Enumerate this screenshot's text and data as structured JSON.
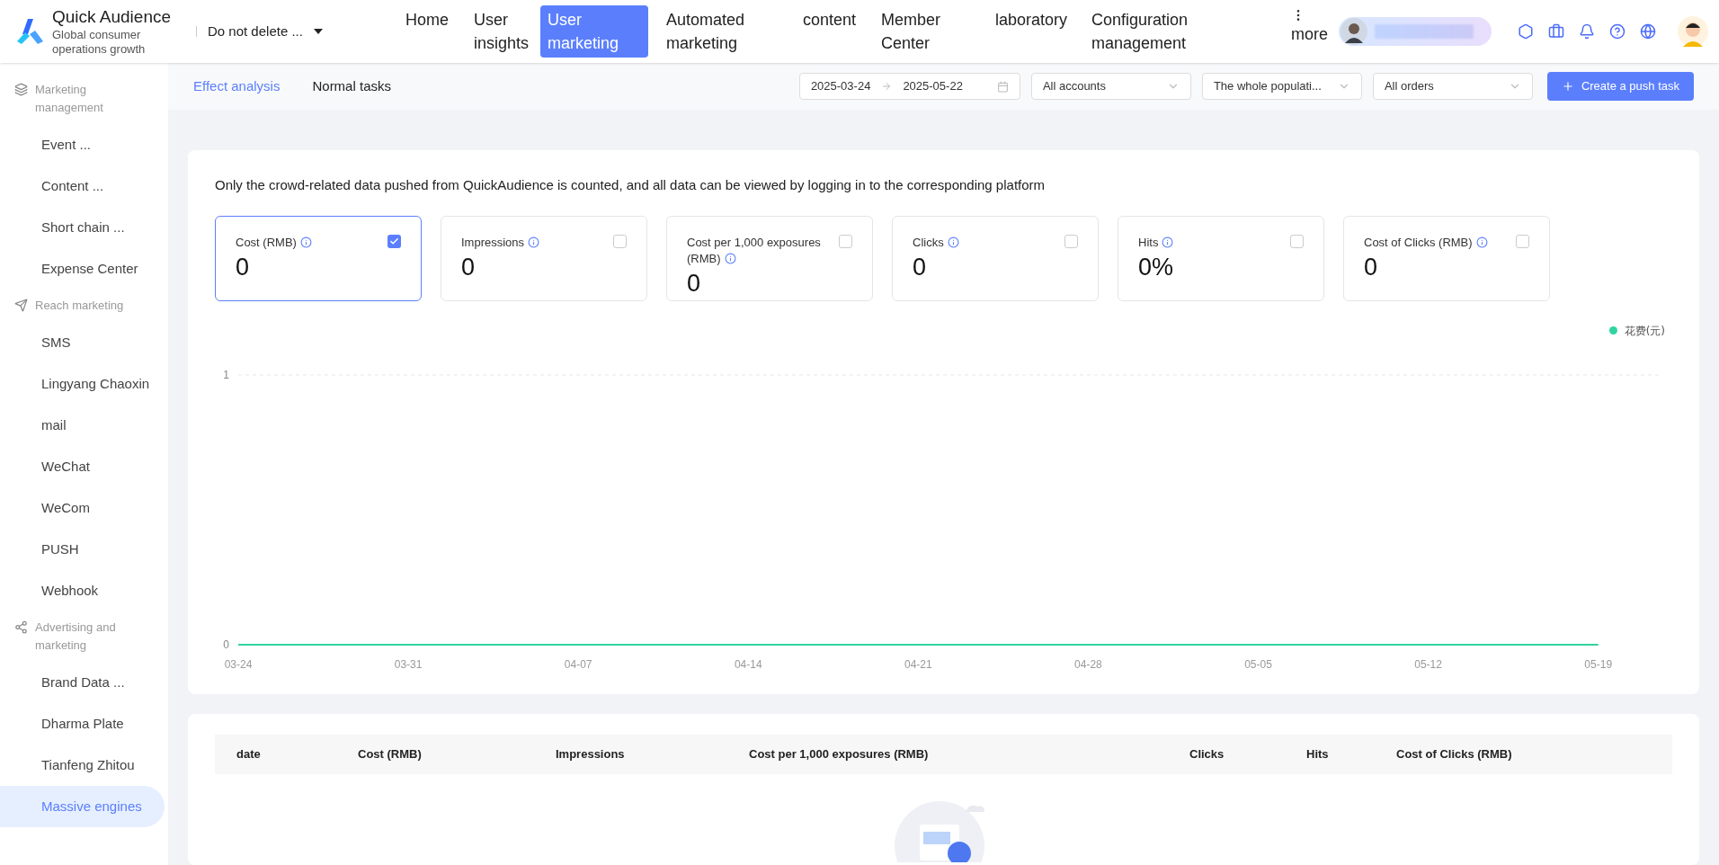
{
  "app": {
    "name": "Quick Audience",
    "tagline": "Global consumer operations growth"
  },
  "workspace": {
    "value": "Do not delete ..."
  },
  "nav": [
    {
      "label": "Home",
      "selected": false
    },
    {
      "label": "User insights",
      "selected": false
    },
    {
      "label": "User marketing",
      "selected": true
    },
    {
      "label": "Automated marketing",
      "selected": false
    },
    {
      "label": "content",
      "selected": false
    },
    {
      "label": "Member Center",
      "selected": false
    },
    {
      "label": "laboratory",
      "selected": false
    },
    {
      "label": "Configuration management",
      "selected": false
    },
    {
      "label": "more",
      "selected": false
    }
  ],
  "sidebar": [
    {
      "title": "Marketing management",
      "kind": "layers",
      "items": [
        {
          "label": "Event ...",
          "selected": false
        },
        {
          "label": "Content ...",
          "selected": false
        },
        {
          "label": "Short chain ...",
          "selected": false
        },
        {
          "label": "Expense Center",
          "selected": false
        }
      ]
    },
    {
      "title": "Reach marketing",
      "kind": "send",
      "items": [
        {
          "label": "SMS",
          "selected": false
        },
        {
          "label": "Lingyang Chaoxin",
          "selected": false
        },
        {
          "label": "mail",
          "selected": false
        },
        {
          "label": "WeChat",
          "selected": false
        },
        {
          "label": "WeCom",
          "selected": false
        },
        {
          "label": "PUSH",
          "selected": false
        },
        {
          "label": "Webhook",
          "selected": false
        }
      ]
    },
    {
      "title": "Advertising and marketing",
      "kind": "nodes",
      "items": [
        {
          "label": "Brand Data ...",
          "selected": false
        },
        {
          "label": "Dharma Plate",
          "selected": false
        },
        {
          "label": "Tianfeng Zhitou",
          "selected": false
        },
        {
          "label": "Massive engines",
          "selected": true
        }
      ]
    }
  ],
  "subtabs": [
    {
      "label": "Effect analysis",
      "selected": true
    },
    {
      "label": "Normal tasks",
      "selected": false
    }
  ],
  "filters": {
    "start_date": "2025-03-24",
    "end_date": "2025-05-22",
    "selects": [
      "All accounts",
      "The whole populati...",
      "All orders"
    ],
    "create_button": "Create a push task"
  },
  "notice": "Only the crowd-related data pushed from QuickAudience is counted, and all data can be viewed by logging in to the corresponding platform",
  "metrics": [
    {
      "label": "Cost (RMB)",
      "value": "0",
      "checked": true
    },
    {
      "label": "Impressions",
      "value": "0",
      "checked": false
    },
    {
      "label": "Cost per 1,000 exposures (RMB)",
      "value": "0",
      "checked": false
    },
    {
      "label": "Clicks",
      "value": "0",
      "checked": false
    },
    {
      "label": "Hits",
      "value": "0%",
      "checked": false
    },
    {
      "label": "Cost of Clicks (RMB)",
      "value": "0",
      "checked": false
    }
  ],
  "chart": {
    "chart_data": {
      "type": "line",
      "categories": [
        "03-24",
        "03-31",
        "04-07",
        "04-14",
        "04-21",
        "04-28",
        "05-05",
        "05-12",
        "05-19"
      ],
      "series": [
        {
          "name": "花费(元)",
          "color": "#2fd4a0",
          "values": [
            0,
            0,
            0,
            0,
            0,
            0,
            0,
            0,
            0
          ]
        }
      ],
      "ylim": [
        0,
        1
      ],
      "yticks": [
        0,
        1
      ]
    }
  },
  "table": {
    "columns": [
      "date",
      "Cost (RMB)",
      "Impressions",
      "Cost per 1,000 exposures (RMB)",
      "Clicks",
      "Hits",
      "Cost of Clicks (RMB)"
    ]
  }
}
